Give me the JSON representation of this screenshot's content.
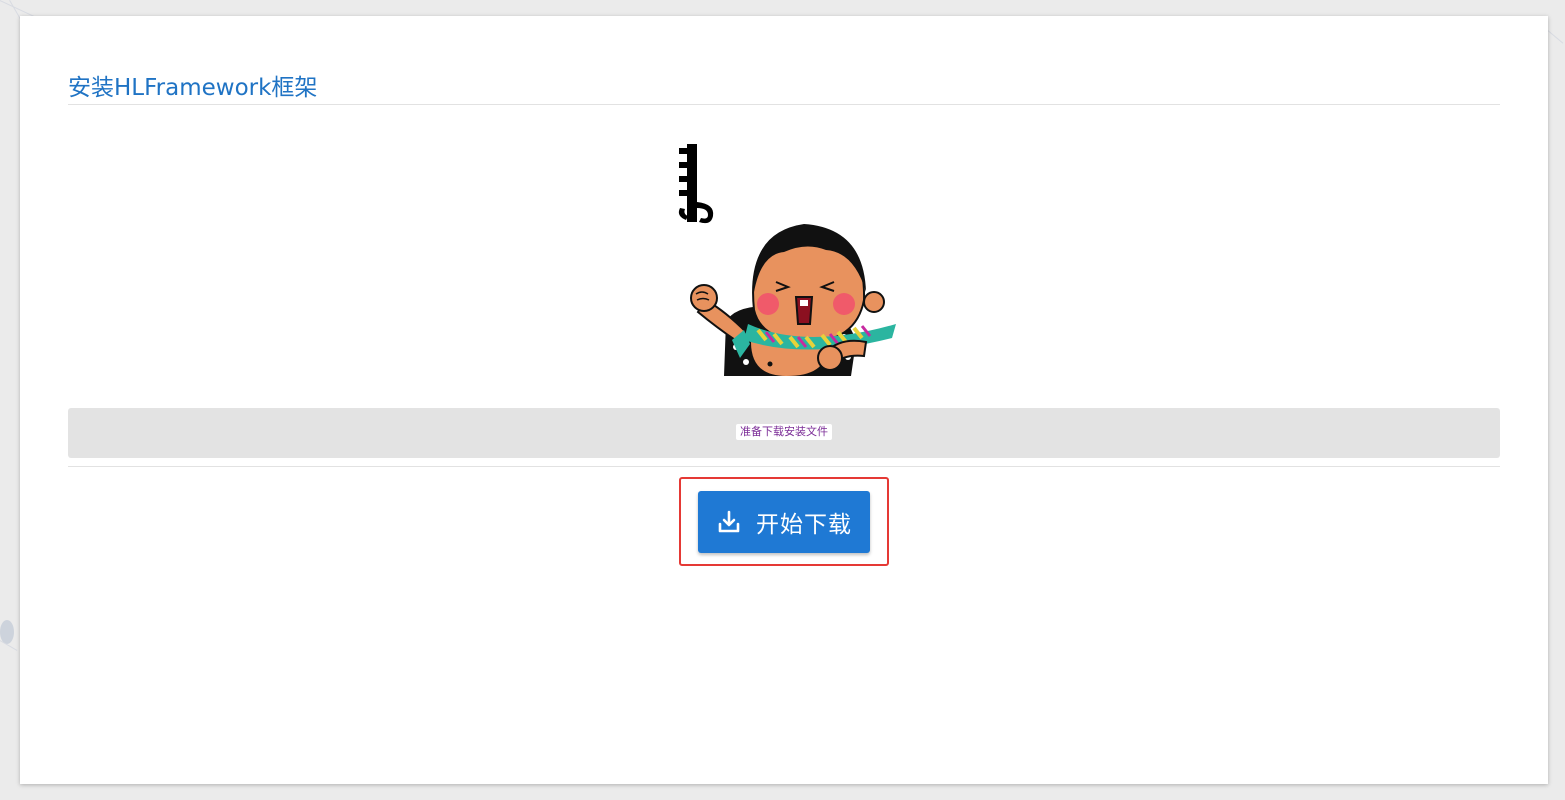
{
  "page": {
    "title": "安装HLFramework框架",
    "status_text": "准备下载安装文件",
    "download_button_label": "开始下载",
    "download_icon": "download-icon",
    "illustration": "cartoon-character-cheering",
    "colors": {
      "accent": "#1f73c4",
      "button": "#1f79d4",
      "status_text": "#7b2c97",
      "highlight_border": "#e53935"
    }
  }
}
